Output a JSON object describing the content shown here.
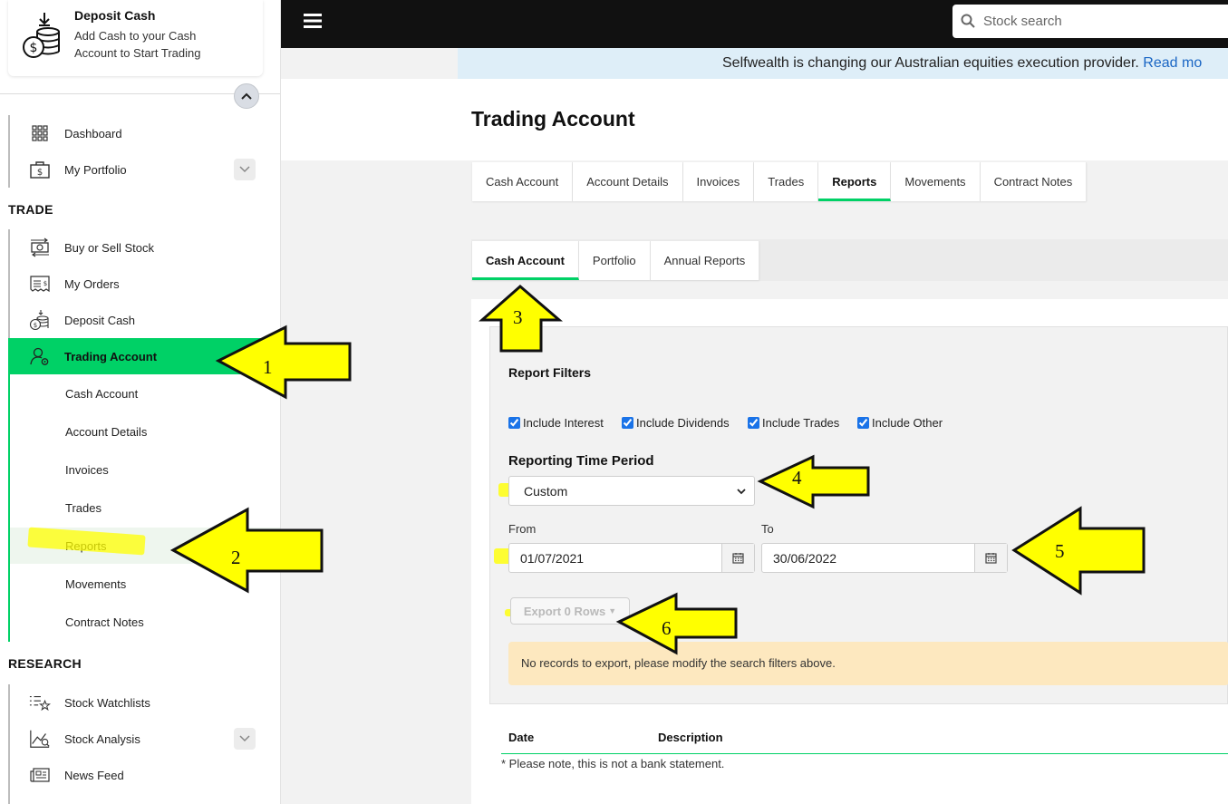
{
  "deposit_card": {
    "title": "Deposit Cash",
    "subtitle": "Add Cash to your Cash Account to Start Trading"
  },
  "sidebar": {
    "top_items": [
      {
        "label": "Dashboard",
        "icon": "grid-icon"
      },
      {
        "label": "My Portfolio",
        "icon": "briefcase-dollar-icon"
      }
    ],
    "trade_section": "TRADE",
    "trade_items": [
      {
        "label": "Buy or Sell Stock",
        "icon": "exchange-cash-icon"
      },
      {
        "label": "My Orders",
        "icon": "receipt-icon"
      },
      {
        "label": "Deposit Cash",
        "icon": "coins-deposit-icon"
      },
      {
        "label": "Trading Account",
        "icon": "user-gear-icon"
      }
    ],
    "sub_items": [
      "Cash Account",
      "Account Details",
      "Invoices",
      "Trades",
      "Reports",
      "Movements",
      "Contract Notes"
    ],
    "research_section": "RESEARCH",
    "research_items": [
      {
        "label": "Stock Watchlists",
        "icon": "list-star-icon"
      },
      {
        "label": "Stock Analysis",
        "icon": "chart-analysis-icon"
      },
      {
        "label": "News Feed",
        "icon": "newspaper-icon"
      }
    ]
  },
  "topbar": {
    "search_placeholder": "Stock search"
  },
  "banner": {
    "text": "Selfwealth is changing our Australian equities execution provider.",
    "link": "Read mo"
  },
  "page": {
    "title": "Trading Account",
    "tabs": [
      "Cash Account",
      "Account Details",
      "Invoices",
      "Trades",
      "Reports",
      "Movements",
      "Contract Notes"
    ],
    "active_tab": "Reports",
    "subtabs": [
      "Cash Account",
      "Portfolio",
      "Annual Reports"
    ],
    "active_subtab": "Cash Account"
  },
  "filters": {
    "title": "Report Filters",
    "checkboxes": [
      {
        "label": "Include Interest",
        "checked": true
      },
      {
        "label": "Include Dividends",
        "checked": true
      },
      {
        "label": "Include Trades",
        "checked": true
      },
      {
        "label": "Include Other",
        "checked": true
      }
    ],
    "period_label": "Reporting Time Period",
    "period_value": "Custom",
    "from_label": "From",
    "from_value": "01/07/2021",
    "to_label": "To",
    "to_value": "30/06/2022",
    "export_label": "Export 0 Rows",
    "no_records": "No records to export, please modify the search filters above."
  },
  "results": {
    "columns": [
      "Date",
      "Description"
    ],
    "note": "* Please note, this is not a bank statement."
  },
  "annotations": [
    "1",
    "2",
    "3",
    "4",
    "5",
    "6"
  ],
  "colors": {
    "accent_green": "#00d166",
    "topbar": "#111111",
    "banner_bg": "#deeef8",
    "warning_bg": "#fde8bf",
    "arrow_yellow": "#ffff00"
  }
}
